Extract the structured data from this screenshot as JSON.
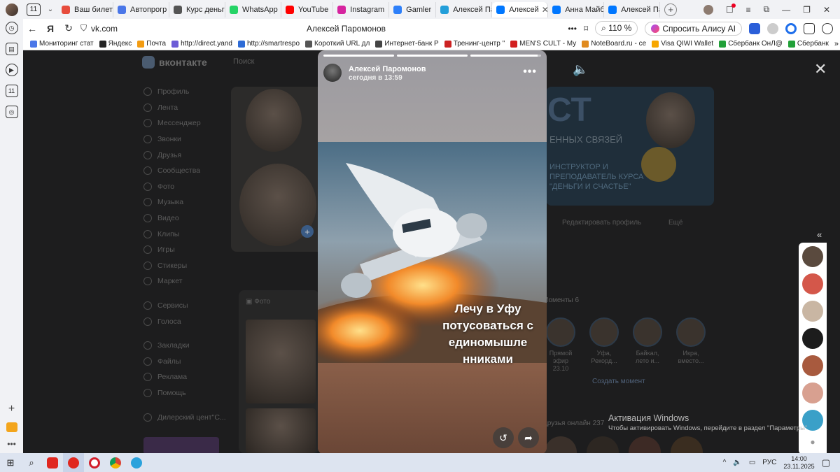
{
  "tabbar": {
    "tab_count": "11",
    "tabs": [
      {
        "label": "Ваш билет",
        "color": "#e74c3c"
      },
      {
        "label": "Автопрогр",
        "color": "#4a76e8"
      },
      {
        "label": "Курс деньг",
        "color": "#555555"
      },
      {
        "label": "WhatsApp",
        "color": "#25d366"
      },
      {
        "label": "YouTube",
        "color": "#ff0000"
      },
      {
        "label": "Instagram",
        "color": "#d6249f"
      },
      {
        "label": "Gamler",
        "color": "#2d7ff9"
      },
      {
        "label": "Алексей Па",
        "color": "#229ed9"
      },
      {
        "label": "Алексей",
        "color": "#0077ff",
        "active": true
      },
      {
        "label": "Анна Майб",
        "color": "#0077ff"
      },
      {
        "label": "Алексей Па",
        "color": "#0077ff"
      }
    ],
    "new_tab": "+"
  },
  "addressbar": {
    "url": "vk.com",
    "page_title": "Алексей Паромонов",
    "zoom": "110 %",
    "alice_label": "Спросить Алису AI"
  },
  "bookmarks": [
    {
      "label": "Мониторинг стат",
      "color": "#4a76e8"
    },
    {
      "label": "Яндекс",
      "color": "#222222"
    },
    {
      "label": "Почта",
      "color": "#f39c12"
    },
    {
      "label": "http://direct.yand",
      "color": "#6b5bd6"
    },
    {
      "label": "http://smartrespo",
      "color": "#2d6bd6"
    },
    {
      "label": "Короткий URL дл",
      "color": "#555555"
    },
    {
      "label": "Интернет-банк Р",
      "color": "#444444"
    },
    {
      "label": "Тренинг-центр \"",
      "color": "#cc2222"
    },
    {
      "label": "MEN'S CULT - Му",
      "color": "#d21f1f"
    },
    {
      "label": "NoteBoard.ru - се",
      "color": "#e08a1e"
    },
    {
      "label": "Visa QIWI Wallet",
      "color": "#f7a600"
    },
    {
      "label": "Сбербанк ОнЛ@",
      "color": "#21a038"
    },
    {
      "label": "Сбербанк",
      "color": "#21a038"
    }
  ],
  "vk": {
    "logo_text": "вконтакте",
    "search_placeholder": "Поиск",
    "menu": [
      "Профиль",
      "Лента",
      "Мессенджер",
      "Звонки",
      "Друзья",
      "Сообщества",
      "Фото",
      "Музыка",
      "Видео",
      "Клипы",
      "Игры",
      "Стикеры",
      "Маркет",
      "Сервисы",
      "Голоса",
      "Закладки",
      "Файлы",
      "Реклама",
      "Помощь",
      "Дилерский цент\"С..."
    ],
    "edit_profile": "Редактировать профиль",
    "more": "Ещё",
    "moments_label": "Моменты",
    "moments_count": "6",
    "create_moment": "Создать момент",
    "friends_online": "Друзья онлайн",
    "friends_online_count": "237",
    "photo_tab": "Фото",
    "moments": [
      "Прямой эфир 23.10",
      "Уфа, Рекорд...",
      "Байкал, лето и...",
      "Икра, вместо..."
    ]
  },
  "story": {
    "author": "Алексей Паромонов",
    "time": "сегодня в 13:59",
    "caption": "Лечу в Уфу потусоваться с единомышле нниками",
    "progress": [
      1.0,
      1.0,
      0.95
    ],
    "more_icon": "more-icon"
  },
  "activation": {
    "title": "Активация Windows",
    "subtitle": "Чтобы активировать Windows, перейдите в раздел \"Параметры\""
  },
  "taskbar": {
    "language": "РУС",
    "time": "14:00",
    "date": "23.11.2025"
  }
}
